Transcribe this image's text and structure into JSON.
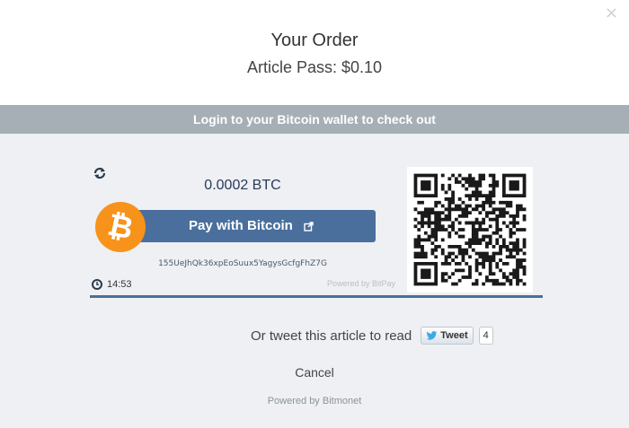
{
  "modal": {
    "close_label": "×",
    "title": "Your Order",
    "item": "Article Pass: $0.10"
  },
  "banner": {
    "text": "Login to your Bitcoin wallet to check out"
  },
  "invoice": {
    "amount": "0.0002 BTC",
    "pay_button_label": "Pay with Bitcoin",
    "btc_symbol": "₿",
    "address": "155UeJhQk36xpEoSuux5YagysGcfgFhZ7G",
    "timer": "14:53",
    "powered_by": "Powered by BitPay",
    "icons": [
      "refresh-icon",
      "bitcoin-logo-icon",
      "external-link-icon",
      "clock-icon",
      "qr-code"
    ],
    "accent_color": "#4a6f9c",
    "bitcoin_color": "#f7931a"
  },
  "tweet": {
    "prompt": "Or tweet this article to read",
    "button_label": "Tweet",
    "count": "4"
  },
  "footer": {
    "cancel_label": "Cancel",
    "powered_by": "Powered by Bitmonet"
  }
}
